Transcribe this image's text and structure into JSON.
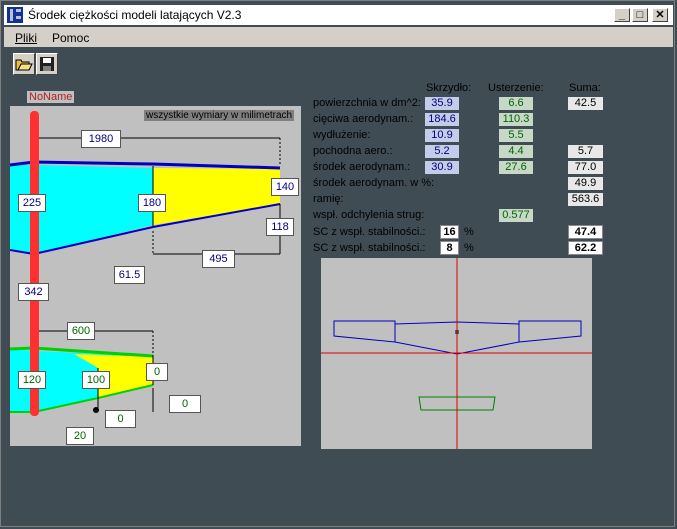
{
  "window": {
    "title": "Środek ciężkości modeli latających V2.3",
    "controls": {
      "minimize": "_",
      "maximize": "□",
      "close": "✕"
    }
  },
  "menu": {
    "items": [
      "Pliki",
      "Pomoc"
    ]
  },
  "toolbar": {
    "buttons": [
      "open-icon",
      "save-icon"
    ]
  },
  "drawing": {
    "model_name": "NoName",
    "units_note": "wszystkie wymiary w milimetrach",
    "wing": {
      "span": "1980",
      "root_chord": "225",
      "mid_chord": "180",
      "tip_chord": "140",
      "tip_offset": "118",
      "sweep_len": "495",
      "le_offset": "61.5"
    },
    "fuselage": {
      "tail_distance": "342"
    },
    "stabilizer": {
      "span": "600",
      "root_chord": "120",
      "mid_chord": "100",
      "tip_chord": "0",
      "tip_offset": "0",
      "sweep": "0",
      "le_offset": "20"
    }
  },
  "results": {
    "headers": {
      "wing": "Skrzydło:",
      "stab": "Usterzenie:",
      "sum": "Suma:"
    },
    "rows": [
      {
        "label": "powierzchnia w dm^2:",
        "wing": "35.9",
        "stab": "6.6",
        "sum": "42.5"
      },
      {
        "label": "cięciwa aerodynam.:",
        "wing": "184.6",
        "stab": "110.3",
        "sum": ""
      },
      {
        "label": "wydłużenie:",
        "wing": "10.9",
        "stab": "5.5",
        "sum": ""
      },
      {
        "label": "pochodna aero.:",
        "wing": "5.2",
        "stab": "4.4",
        "sum": "5.7"
      },
      {
        "label": "środek aerodynam.:",
        "wing": "30.9",
        "stab": "27.6",
        "sum": "77.0"
      },
      {
        "label": "środek aerodynam. w %:",
        "wing": "",
        "stab": "",
        "sum": "49.9"
      },
      {
        "label": "ramię:",
        "wing": "",
        "stab": "",
        "sum": "563.6"
      },
      {
        "label": "wspł. odchylenia strug:",
        "wing": "",
        "stab": "0.577",
        "sum": ""
      }
    ],
    "sc1": {
      "label": "SC z wspł. stabilności.:",
      "input": "16",
      "unit": "%",
      "sum": "47.4"
    },
    "sc2": {
      "label": "SC z wspł. stabilności.:",
      "input": "8",
      "unit": "%",
      "sum": "62.2"
    }
  },
  "colors": {
    "wing_fill": "#00ffff",
    "stab_outline": "#00c000",
    "wing_outline": "#0000c0",
    "fuselage": "#ff3030",
    "yellow": "#ffff00"
  }
}
